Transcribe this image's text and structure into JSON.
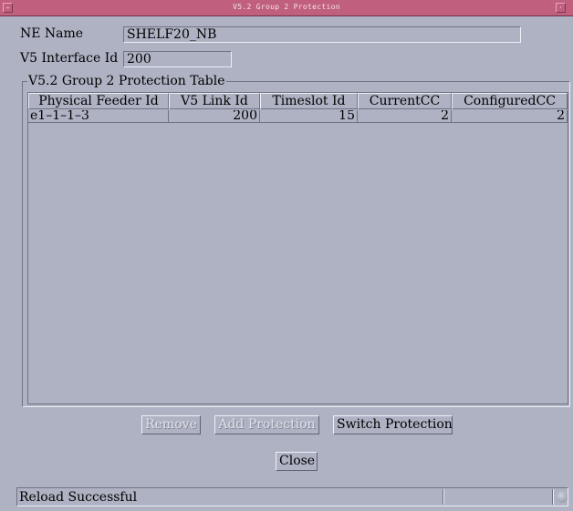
{
  "window": {
    "title": "V5.2 Group 2 Protection",
    "menu_glyph": "–",
    "close_glyph": "·"
  },
  "ne_name": {
    "label": "NE Name",
    "value": "SHELF20_NB"
  },
  "v5_interface": {
    "label": "V5 Interface Id",
    "value": "200"
  },
  "table": {
    "title": "V5.2 Group 2 Protection Table",
    "columns": [
      "Physical Feeder Id",
      "V5 Link Id",
      "Timeslot Id",
      "CurrentCC",
      "ConfiguredCC"
    ],
    "rows": [
      [
        "e1–1–1–3",
        "200",
        "15",
        "2",
        "2"
      ]
    ]
  },
  "buttons": {
    "remove": "Remove",
    "add_protection": "Add Protection",
    "switch_protection": "Switch Protection",
    "close": "Close"
  },
  "status": {
    "message": "Reload Successful"
  }
}
